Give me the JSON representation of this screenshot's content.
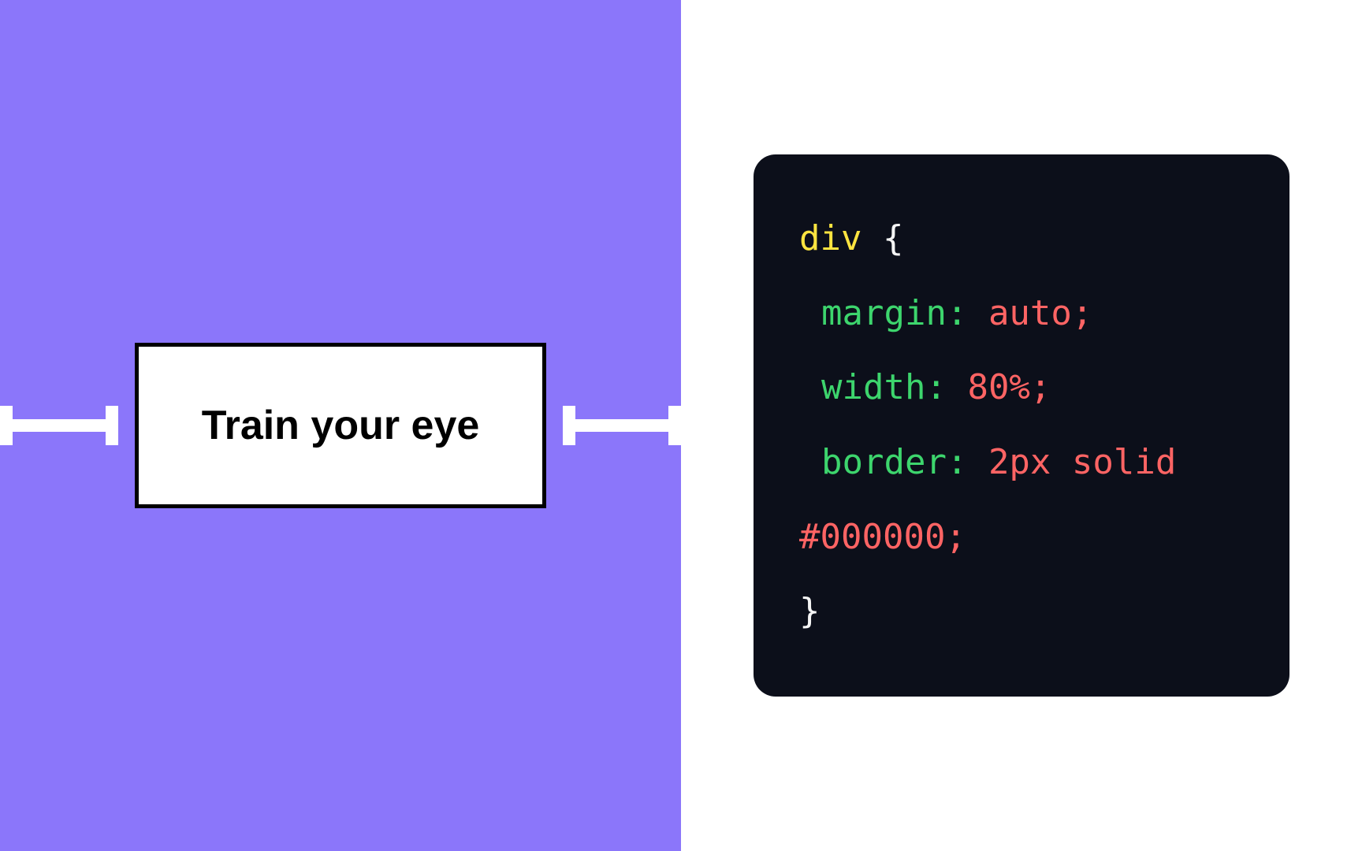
{
  "left": {
    "label": "Train your eye"
  },
  "code": {
    "selector": "div",
    "brace_open": "{",
    "brace_close": "}",
    "lines": [
      {
        "property": "margin:",
        "value": "auto;"
      },
      {
        "property": "width:",
        "value": "80%;"
      },
      {
        "property": "border:",
        "value": "2px solid #000000;"
      }
    ]
  },
  "colors": {
    "accent_bg": "#8B76FA",
    "code_bg": "#0C0F1A",
    "selector": "#FEE440",
    "property": "#3DD56D",
    "value": "#FF6464",
    "brace": "#F5F5F5"
  }
}
